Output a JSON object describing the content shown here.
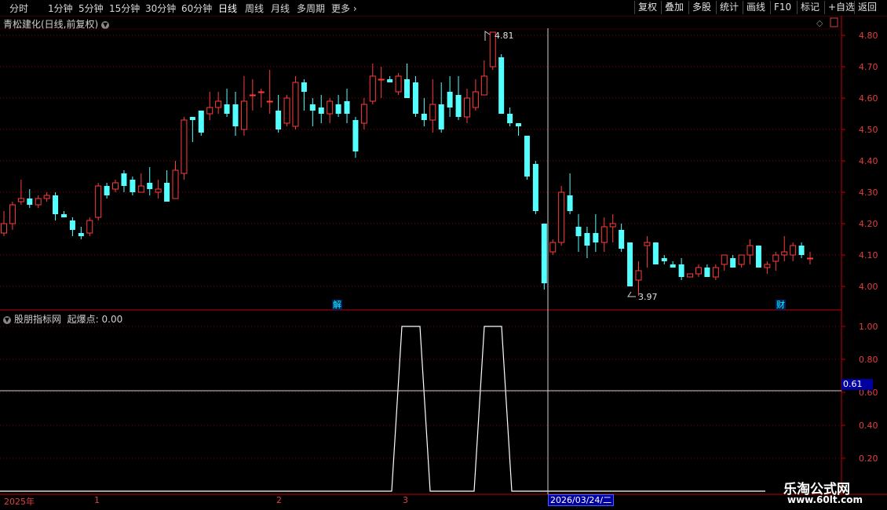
{
  "toolbar": {
    "periods": [
      "分时",
      "1分钟",
      "5分钟",
      "15分钟",
      "30分钟",
      "60分钟",
      "日线",
      "周线",
      "月线",
      "多周期",
      "更多"
    ],
    "active_period": "日线",
    "right_buttons": [
      "复权",
      "叠加",
      "多股",
      "统计",
      "画线",
      "F10",
      "标记",
      "+自选",
      "返回"
    ]
  },
  "stock": {
    "title": "青松建化(日线,前复权)"
  },
  "price_axis": {
    "labels": [
      "4.80",
      "4.70",
      "4.60",
      "4.50",
      "4.40",
      "4.30",
      "4.20",
      "4.10",
      "4.00"
    ]
  },
  "annotations": {
    "high": "4.81",
    "low": "3.97",
    "marker_a": "解",
    "marker_b": "财"
  },
  "indicator": {
    "title": "股朋指标网",
    "label": "起爆点: 0.00",
    "axis_labels": [
      "1.00",
      "0.80",
      "0.60",
      "0.40",
      "0.20"
    ],
    "cursor_value": "0.61"
  },
  "x_axis": {
    "labels": [
      "2025年",
      "1",
      "2",
      "3"
    ],
    "cursor_date": "2026/03/24/二"
  },
  "watermark": {
    "line1": "乐淘公式网",
    "line2": "www.60lt.com"
  },
  "colors": {
    "up": "#ff3c3c",
    "down": "#54ffff",
    "grid": "#8a0000",
    "axis": "#c00000"
  },
  "chart_data": {
    "type": "candlestick",
    "ylim": [
      3.97,
      4.84
    ],
    "candles": [
      [
        4.17,
        4.2,
        4.24,
        4.16
      ],
      [
        4.2,
        4.26,
        4.27,
        4.18
      ],
      [
        4.27,
        4.28,
        4.34,
        4.26
      ],
      [
        4.28,
        4.26,
        4.31,
        4.25
      ],
      [
        4.26,
        4.28,
        4.29,
        4.25
      ],
      [
        4.28,
        4.29,
        4.3,
        4.27
      ],
      [
        4.29,
        4.23,
        4.3,
        4.21
      ],
      [
        4.23,
        4.22,
        4.24,
        4.22
      ],
      [
        4.21,
        4.18,
        4.22,
        4.16
      ],
      [
        4.17,
        4.16,
        4.19,
        4.15
      ],
      [
        4.17,
        4.21,
        4.22,
        4.16
      ],
      [
        4.22,
        4.32,
        4.33,
        4.21
      ],
      [
        4.32,
        4.29,
        4.33,
        4.28
      ],
      [
        4.31,
        4.33,
        4.34,
        4.3
      ],
      [
        4.36,
        4.32,
        4.37,
        4.3
      ],
      [
        4.34,
        4.3,
        4.35,
        4.29
      ],
      [
        4.3,
        4.32,
        4.36,
        4.31
      ],
      [
        4.33,
        4.31,
        4.38,
        4.29
      ],
      [
        4.3,
        4.31,
        4.34,
        4.28
      ],
      [
        4.33,
        4.27,
        4.37,
        4.28
      ],
      [
        4.28,
        4.37,
        4.4,
        4.29
      ],
      [
        4.36,
        4.53,
        4.54,
        4.34
      ],
      [
        4.54,
        4.53,
        4.53,
        4.46
      ],
      [
        4.56,
        4.49,
        4.56,
        4.48
      ],
      [
        4.55,
        4.57,
        4.62,
        4.53
      ],
      [
        4.57,
        4.59,
        4.62,
        4.55
      ],
      [
        4.58,
        4.55,
        4.63,
        4.54
      ],
      [
        4.58,
        4.51,
        4.62,
        4.48
      ],
      [
        4.5,
        4.59,
        4.67,
        4.48
      ],
      [
        4.61,
        4.61,
        4.66,
        4.56
      ],
      [
        4.62,
        4.62,
        4.63,
        4.57
      ],
      [
        4.59,
        4.59,
        4.69,
        4.55
      ],
      [
        4.56,
        4.5,
        4.61,
        4.49
      ],
      [
        4.52,
        4.6,
        4.61,
        4.51
      ],
      [
        4.51,
        4.65,
        4.67,
        4.5
      ],
      [
        4.65,
        4.62,
        4.66,
        4.56
      ],
      [
        4.58,
        4.56,
        4.6,
        4.51
      ],
      [
        4.57,
        4.55,
        4.61,
        4.52
      ],
      [
        4.55,
        4.59,
        4.6,
        4.52
      ],
      [
        4.58,
        4.55,
        4.61,
        4.54
      ],
      [
        4.59,
        4.55,
        4.63,
        4.52
      ],
      [
        4.53,
        4.43,
        4.54,
        4.41
      ],
      [
        4.52,
        4.58,
        4.6,
        4.5
      ],
      [
        4.59,
        4.67,
        4.71,
        4.58
      ],
      [
        4.66,
        4.66,
        4.7,
        4.6
      ],
      [
        4.66,
        4.65,
        4.67,
        4.65
      ],
      [
        4.62,
        4.67,
        4.68,
        4.61
      ],
      [
        4.66,
        4.6,
        4.71,
        4.61
      ],
      [
        4.65,
        4.55,
        4.67,
        4.54
      ],
      [
        4.55,
        4.53,
        4.6,
        4.51
      ],
      [
        4.53,
        4.58,
        4.66,
        4.49
      ],
      [
        4.58,
        4.5,
        4.65,
        4.49
      ],
      [
        4.62,
        4.57,
        4.67,
        4.54
      ],
      [
        4.61,
        4.54,
        4.67,
        4.53
      ],
      [
        4.54,
        4.6,
        4.63,
        4.52
      ],
      [
        4.57,
        4.62,
        4.66,
        4.56
      ],
      [
        4.61,
        4.67,
        4.72,
        4.61
      ],
      [
        4.7,
        4.81,
        4.81,
        4.69
      ],
      [
        4.73,
        4.55,
        4.74,
        4.55
      ],
      [
        4.55,
        4.52,
        4.57,
        4.51
      ],
      [
        4.52,
        4.51,
        4.52,
        4.48
      ],
      [
        4.48,
        4.35,
        4.48,
        4.34
      ],
      [
        4.39,
        4.24,
        4.4,
        4.23
      ],
      [
        4.2,
        4.01,
        4.2,
        3.99
      ],
      [
        4.11,
        4.14,
        4.15,
        4.1
      ],
      [
        4.14,
        4.3,
        4.32,
        4.13
      ],
      [
        4.29,
        4.24,
        4.36,
        4.23
      ],
      [
        4.19,
        4.16,
        4.23,
        4.11
      ],
      [
        4.17,
        4.13,
        4.19,
        4.09
      ],
      [
        4.17,
        4.14,
        4.23,
        4.11
      ],
      [
        4.14,
        4.19,
        4.22,
        4.11
      ],
      [
        4.19,
        4.2,
        4.23,
        4.14
      ],
      [
        4.18,
        4.12,
        4.2,
        4.11
      ],
      [
        4.14,
        4.0,
        4.14,
        4.0
      ],
      [
        4.02,
        4.05,
        4.08,
        3.97
      ],
      [
        4.13,
        4.14,
        4.16,
        4.06
      ],
      [
        4.14,
        4.07,
        4.14,
        4.07
      ],
      [
        4.09,
        4.08,
        4.1,
        4.07
      ],
      [
        4.07,
        4.06,
        4.08,
        4.06
      ],
      [
        4.07,
        4.03,
        4.09,
        4.02
      ],
      [
        4.03,
        4.04,
        4.04,
        4.03
      ],
      [
        4.04,
        4.06,
        4.07,
        4.03
      ],
      [
        4.06,
        4.03,
        4.07,
        4.03
      ],
      [
        4.03,
        4.06,
        4.07,
        4.02
      ],
      [
        4.07,
        4.1,
        4.1,
        4.05
      ],
      [
        4.09,
        4.06,
        4.1,
        4.06
      ],
      [
        4.07,
        4.1,
        4.1,
        4.06
      ],
      [
        4.1,
        4.13,
        4.15,
        4.07
      ],
      [
        4.13,
        4.06,
        4.13,
        4.06
      ],
      [
        4.06,
        4.07,
        4.08,
        4.04
      ],
      [
        4.08,
        4.1,
        4.11,
        4.05
      ],
      [
        4.1,
        4.11,
        4.16,
        4.08
      ],
      [
        4.1,
        4.13,
        4.14,
        4.08
      ],
      [
        4.13,
        4.1,
        4.14,
        4.09
      ],
      [
        4.09,
        4.09,
        4.11,
        4.07
      ]
    ],
    "indicator_ylim": [
      0.0,
      1.0
    ],
    "indicator_points": [
      [
        0,
        0.0
      ],
      [
        499,
        0.0
      ],
      [
        512,
        1.0
      ],
      [
        535,
        1.0
      ],
      [
        548,
        0.0
      ],
      [
        604,
        0.0
      ],
      [
        617,
        1.0
      ],
      [
        639,
        1.0
      ],
      [
        652,
        0.0
      ],
      [
        975,
        0.0
      ]
    ]
  }
}
